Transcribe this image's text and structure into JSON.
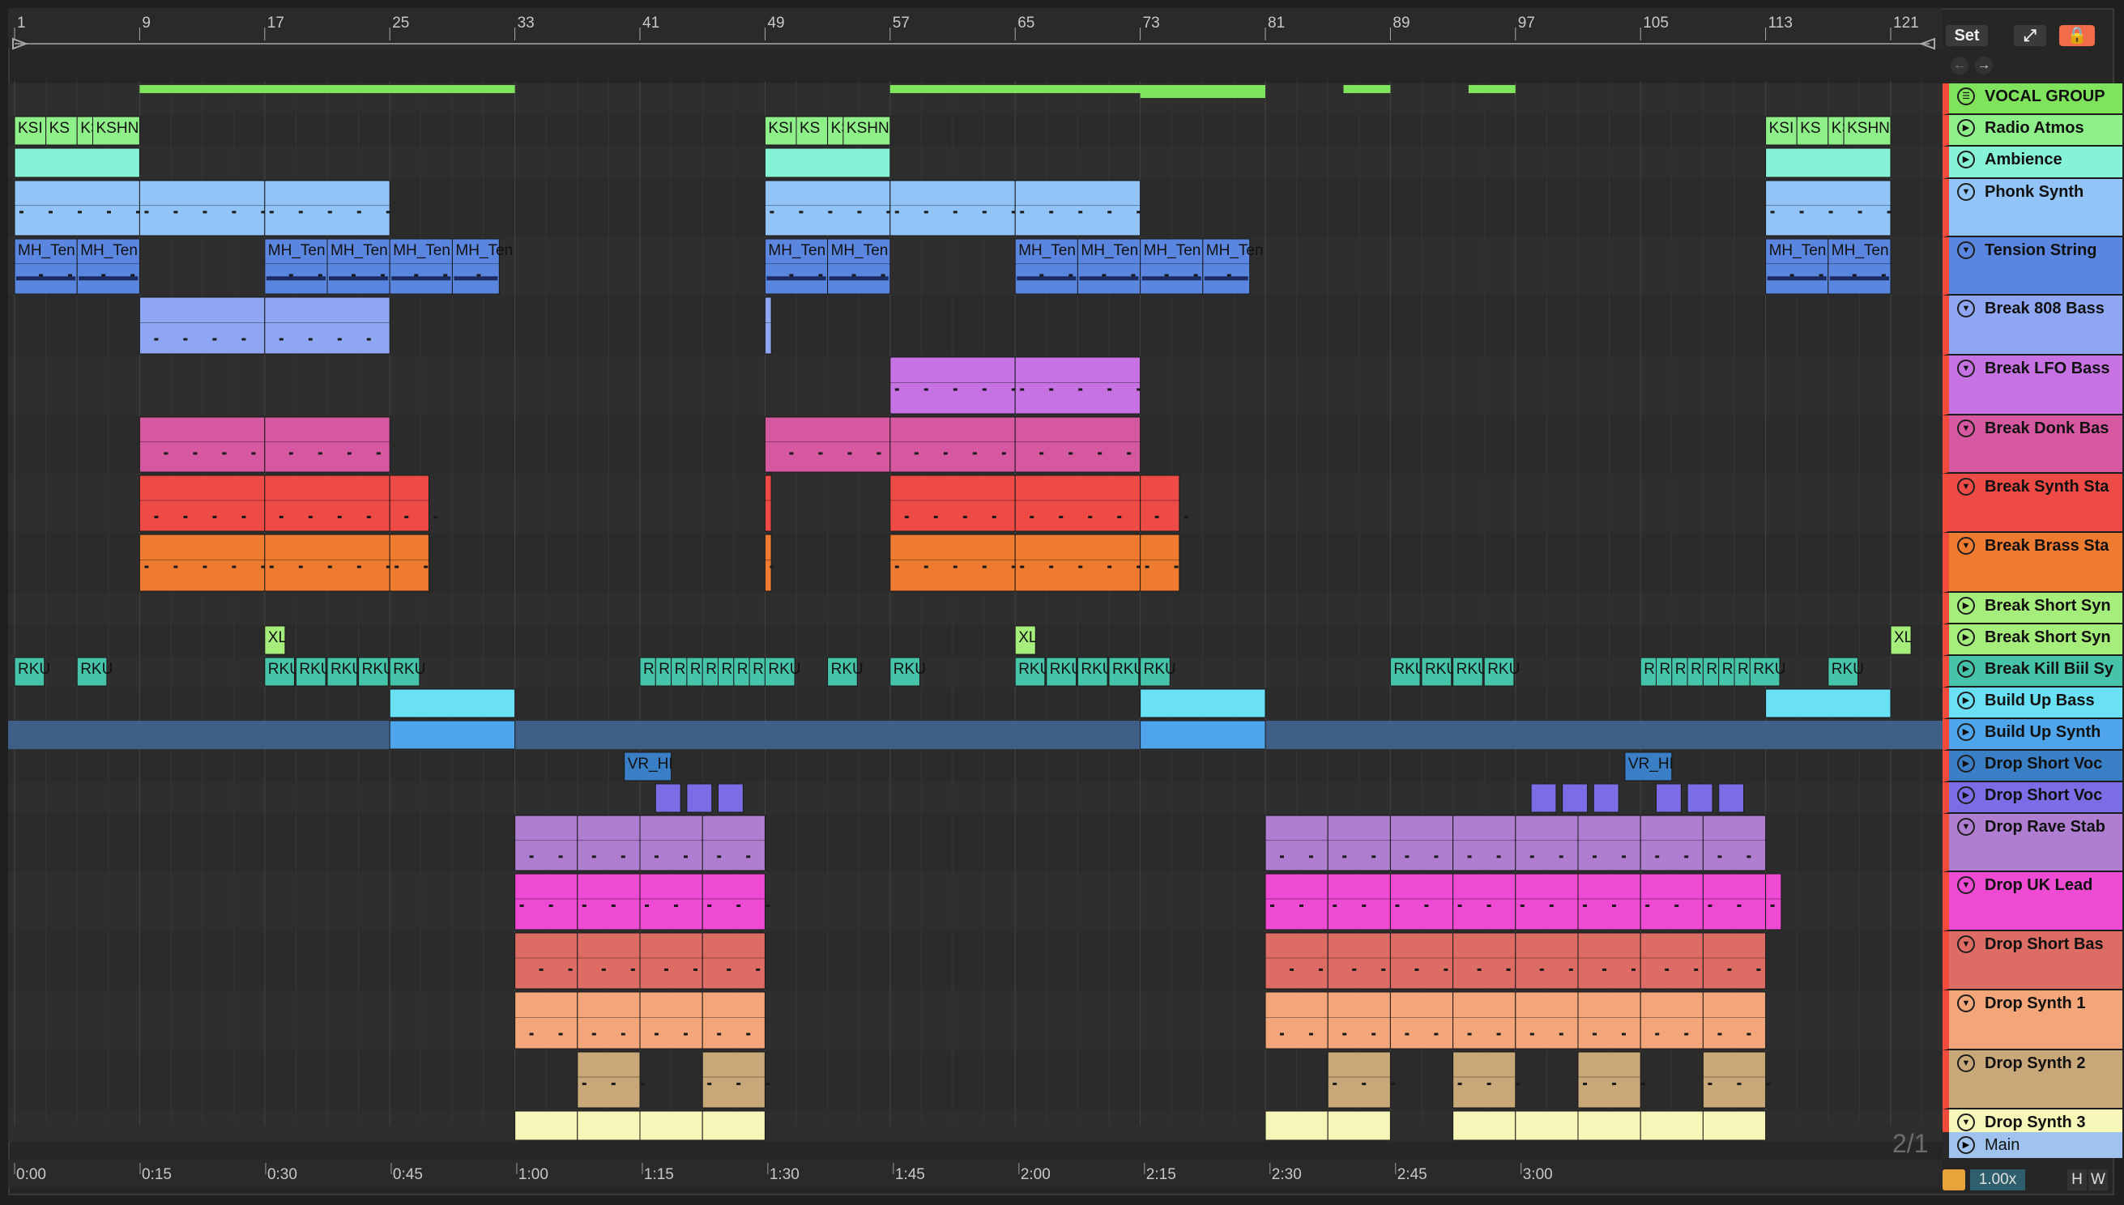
{
  "ruler": {
    "bars": [
      "1",
      "9",
      "17",
      "25",
      "33",
      "41",
      "49",
      "57",
      "65",
      "73",
      "81",
      "89",
      "97",
      "105",
      "113",
      "121"
    ]
  },
  "timeline": [
    "0:00",
    "0:15",
    "0:30",
    "0:45",
    "1:00",
    "1:15",
    "1:30",
    "1:45",
    "2:00",
    "2:15",
    "2:30",
    "2:45",
    "3:00"
  ],
  "controls": {
    "set_label": "Set",
    "loop_ratio": "2/1",
    "tempo_rate": "1.00x",
    "h_label": "H",
    "w_label": "W",
    "main_track": "Main"
  },
  "tracks": [
    {
      "name": "VOCAL GROUP",
      "color": "#7fe35b",
      "icon": "group-icon"
    },
    {
      "name": "Radio Atmos",
      "color": "#8ff08a",
      "icon": "play-icon"
    },
    {
      "name": "Ambience",
      "color": "#86f2d6",
      "icon": "play-icon"
    },
    {
      "name": "Phonk Synth",
      "color": "#92c4f7",
      "icon": "fold-icon"
    },
    {
      "name": "Tension String",
      "color": "#5b86e0",
      "icon": "fold-icon"
    },
    {
      "name": "Break 808 Bass",
      "color": "#8fa7f2",
      "icon": "fold-icon"
    },
    {
      "name": "Break LFO Bass",
      "color": "#c672e3",
      "icon": "fold-icon"
    },
    {
      "name": "Break Donk Bas",
      "color": "#d658a0",
      "icon": "fold-icon"
    },
    {
      "name": "Break Synth Sta",
      "color": "#ee4a46",
      "icon": "fold-icon"
    },
    {
      "name": "Break Brass Sta",
      "color": "#ee7b30",
      "icon": "fold-icon"
    },
    {
      "name": "Break Short Syn",
      "color": "#a6ee7c",
      "icon": "play-icon"
    },
    {
      "name": "Break Short Syn",
      "color": "#a6ee7c",
      "icon": "play-icon"
    },
    {
      "name": "Break Kill Biil Sy",
      "color": "#46c4a9",
      "icon": "play-icon"
    },
    {
      "name": "Build Up Bass",
      "color": "#6ae0f5",
      "icon": "play-icon"
    },
    {
      "name": "Build Up Synth",
      "color": "#4ea5ec",
      "icon": "play-icon"
    },
    {
      "name": "Drop Short Voc",
      "color": "#3a7ec5",
      "icon": "play-icon"
    },
    {
      "name": "Drop Short Voc",
      "color": "#7a6de6",
      "icon": "play-icon"
    },
    {
      "name": "Drop Rave Stab",
      "color": "#b07ed0",
      "icon": "fold-icon"
    },
    {
      "name": "Drop UK Lead",
      "color": "#ee4ad4",
      "icon": "fold-icon"
    },
    {
      "name": "Drop Short Bas",
      "color": "#dd6d64",
      "icon": "fold-icon"
    },
    {
      "name": "Drop Synth 1",
      "color": "#f3a67a",
      "icon": "fold-icon"
    },
    {
      "name": "Drop Synth 2",
      "color": "#c8a879",
      "icon": "fold-icon"
    },
    {
      "name": "Drop Synth 3",
      "color": "#f6f6b8",
      "icon": "fold-icon"
    }
  ],
  "clip_names": {
    "radio": [
      "KSI",
      "KS",
      "KS",
      "KSHN"
    ],
    "tension": "MH_Ten",
    "short_syn": "XL",
    "kill": "RKU",
    "kill_short": "R",
    "drop_voc": "VR_HI"
  }
}
